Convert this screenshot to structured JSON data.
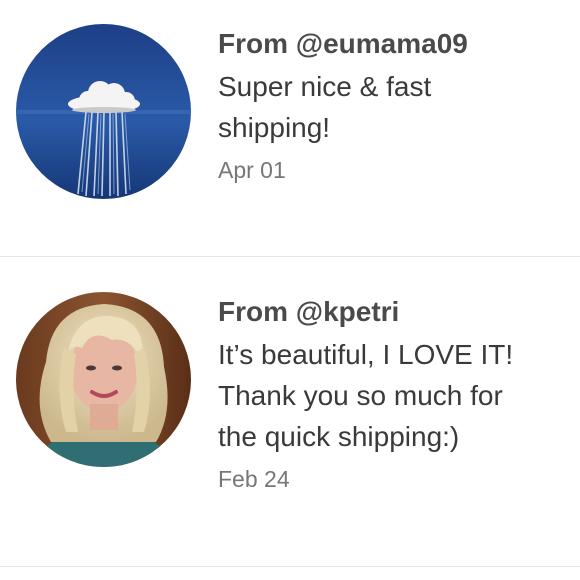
{
  "reviews": [
    {
      "from_label": "From @eumama09",
      "comment_lines": [
        "Super nice & fast",
        "shipping!"
      ],
      "date": "Apr 01",
      "avatar_icon": "cloud-rain-avatar"
    },
    {
      "from_label": "From @kpetri",
      "comment_lines": [
        "It’s beautiful, I LOVE IT!",
        "Thank you so much for",
        "the quick shipping:)"
      ],
      "date": "Feb 24",
      "avatar_icon": "profile-photo-avatar"
    }
  ],
  "colors": {
    "divider": "#e6e6e6",
    "username_text": "#4a4a4a",
    "comment_text": "#3a3a3a",
    "date_text": "#777777"
  }
}
